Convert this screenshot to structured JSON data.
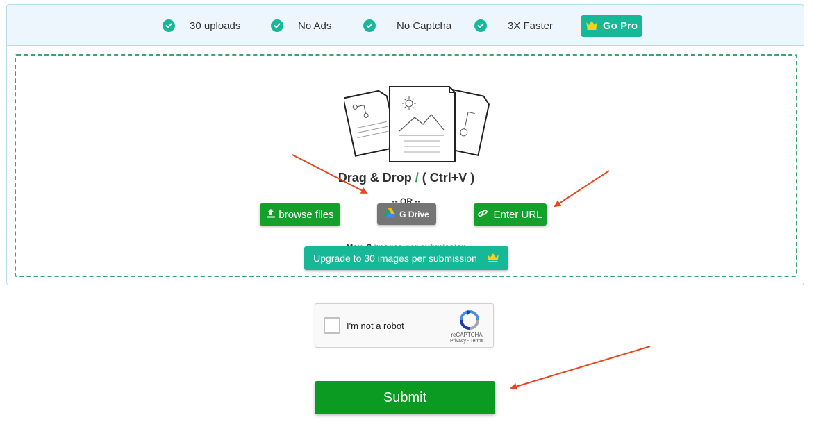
{
  "feature_bar": {
    "features": [
      {
        "label": "30 uploads",
        "icon": "check-circle-icon"
      },
      {
        "label": "No Ads",
        "icon": "check-circle-icon"
      },
      {
        "label": "No Captcha",
        "icon": "check-circle-icon"
      },
      {
        "label": "3X Faster",
        "icon": "check-circle-icon"
      }
    ],
    "go_pro_label": "Go Pro",
    "go_pro_icon": "crown-icon"
  },
  "upload": {
    "drop_title_main": "Drag & Drop",
    "drop_title_slash": "/",
    "drop_title_shortcut": "( Ctrl+V )",
    "or_text": "-- OR --",
    "browse_label": "browse files",
    "gdrive_label": "G Drive",
    "url_label": "Enter URL",
    "max_note": "Max. 3 images per submission",
    "upgrade_label": "Upgrade to 30 images per submission"
  },
  "captcha": {
    "label": "I'm not a robot",
    "brand": "reCAPTCHA",
    "privacy": "Privacy",
    "separator": " - ",
    "terms": "Terms"
  },
  "submit_label": "Submit",
  "colors": {
    "teal": "#17b897",
    "green": "#13a12b",
    "submit_green": "#0c9b22",
    "gray_button": "#757575",
    "arrow": "#e8461e",
    "crown": "#f7d21c"
  }
}
